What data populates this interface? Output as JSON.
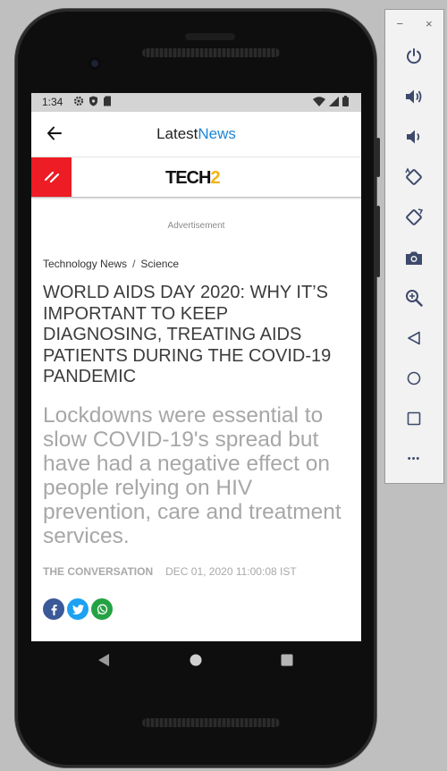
{
  "status": {
    "time": "1:34"
  },
  "appbar": {
    "title_prefix": "Latest",
    "title_suffix": "News"
  },
  "brand": {
    "logo_main": "TECH",
    "logo_num": "2"
  },
  "ad_label": "Advertisement",
  "breadcrumb": {
    "items": [
      "Technology News",
      "Science"
    ],
    "separator": "/"
  },
  "article": {
    "headline": "WORLD AIDS DAY 2020: WHY IT’S IMPORTANT TO KEEP DIAGNOSING, TREATING AIDS PATIENTS DURING THE COVID-19 PANDEMIC",
    "summary": "Lockdowns were essential to slow COVID-19's spread but have had a negative effect on people relying on HIV prevention, care and treatment services.",
    "source": "THE CONVERSATION",
    "date": "DEC 01, 2020 11:00:08 IST"
  },
  "share": {
    "facebook": "f",
    "twitter": "t",
    "whatsapp": "w"
  },
  "colors": {
    "accent": "#1c86d8",
    "brand_red": "#ee1c24",
    "logo_yellow": "#f2b416",
    "facebook": "#3b5998",
    "twitter": "#1da1f2",
    "whatsapp": "#25a244"
  },
  "emulator_panel": {
    "minimize": "−",
    "close": "×",
    "more": "•••"
  }
}
